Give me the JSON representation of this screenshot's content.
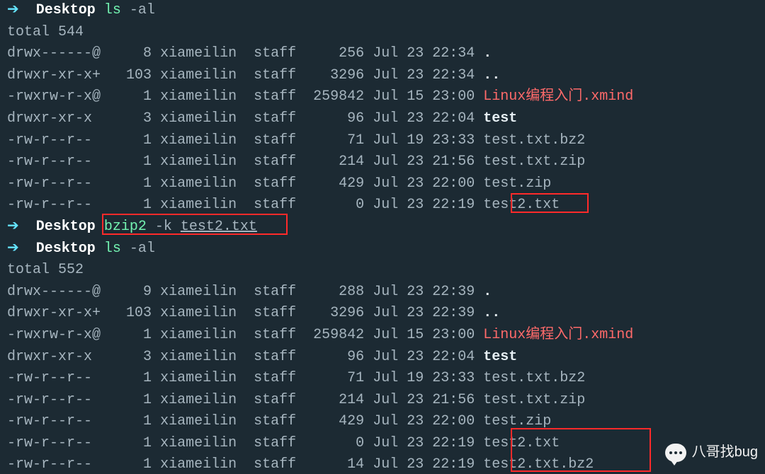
{
  "prompt": {
    "arrow": "➔",
    "path": "Desktop"
  },
  "cmd1": {
    "cmd": "ls",
    "args": "-al"
  },
  "total1": "total 544",
  "rows1": [
    {
      "perm": "drwx------@",
      "links": "8",
      "user": "xiameilin",
      "group": "staff",
      "size": "256",
      "date": "Jul 23 22:34",
      "name": ".",
      "kind": "bold"
    },
    {
      "perm": "drwxr-xr-x+",
      "links": "103",
      "user": "xiameilin",
      "group": "staff",
      "size": "3296",
      "date": "Jul 23 22:34",
      "name": "..",
      "kind": "bold"
    },
    {
      "perm": "-rwxrw-r-x@",
      "links": "1",
      "user": "xiameilin",
      "group": "staff",
      "size": "259842",
      "date": "Jul 15 23:00",
      "name": "Linux编程入门.xmind",
      "kind": "red"
    },
    {
      "perm": "drwxr-xr-x",
      "links": "3",
      "user": "xiameilin",
      "group": "staff",
      "size": "96",
      "date": "Jul 23 22:04",
      "name": "test",
      "kind": "bold"
    },
    {
      "perm": "-rw-r--r--",
      "links": "1",
      "user": "xiameilin",
      "group": "staff",
      "size": "71",
      "date": "Jul 19 23:33",
      "name": "test.txt.bz2",
      "kind": "txt"
    },
    {
      "perm": "-rw-r--r--",
      "links": "1",
      "user": "xiameilin",
      "group": "staff",
      "size": "214",
      "date": "Jul 23 21:56",
      "name": "test.txt.zip",
      "kind": "txt"
    },
    {
      "perm": "-rw-r--r--",
      "links": "1",
      "user": "xiameilin",
      "group": "staff",
      "size": "429",
      "date": "Jul 23 22:00",
      "name": "test.zip",
      "kind": "txt"
    },
    {
      "perm": "-rw-r--r--",
      "links": "1",
      "user": "xiameilin",
      "group": "staff",
      "size": "0",
      "date": "Jul 23 22:19",
      "name": "test2.txt",
      "kind": "txt"
    }
  ],
  "cmd2": {
    "cmd": "bzip2",
    "flag": "-k",
    "arg": "test2.txt"
  },
  "cmd3": {
    "cmd": "ls",
    "args": "-al"
  },
  "total2": "total 552",
  "rows2": [
    {
      "perm": "drwx------@",
      "links": "9",
      "user": "xiameilin",
      "group": "staff",
      "size": "288",
      "date": "Jul 23 22:39",
      "name": ".",
      "kind": "bold"
    },
    {
      "perm": "drwxr-xr-x+",
      "links": "103",
      "user": "xiameilin",
      "group": "staff",
      "size": "3296",
      "date": "Jul 23 22:39",
      "name": "..",
      "kind": "bold"
    },
    {
      "perm": "-rwxrw-r-x@",
      "links": "1",
      "user": "xiameilin",
      "group": "staff",
      "size": "259842",
      "date": "Jul 15 23:00",
      "name": "Linux编程入门.xmind",
      "kind": "red"
    },
    {
      "perm": "drwxr-xr-x",
      "links": "3",
      "user": "xiameilin",
      "group": "staff",
      "size": "96",
      "date": "Jul 23 22:04",
      "name": "test",
      "kind": "bold"
    },
    {
      "perm": "-rw-r--r--",
      "links": "1",
      "user": "xiameilin",
      "group": "staff",
      "size": "71",
      "date": "Jul 19 23:33",
      "name": "test.txt.bz2",
      "kind": "txt"
    },
    {
      "perm": "-rw-r--r--",
      "links": "1",
      "user": "xiameilin",
      "group": "staff",
      "size": "214",
      "date": "Jul 23 21:56",
      "name": "test.txt.zip",
      "kind": "txt"
    },
    {
      "perm": "-rw-r--r--",
      "links": "1",
      "user": "xiameilin",
      "group": "staff",
      "size": "429",
      "date": "Jul 23 22:00",
      "name": "test.zip",
      "kind": "txt"
    },
    {
      "perm": "-rw-r--r--",
      "links": "1",
      "user": "xiameilin",
      "group": "staff",
      "size": "0",
      "date": "Jul 23 22:19",
      "name": "test2.txt",
      "kind": "txt"
    },
    {
      "perm": "-rw-r--r--",
      "links": "1",
      "user": "xiameilin",
      "group": "staff",
      "size": "14",
      "date": "Jul 23 22:19",
      "name": "test2.txt.bz2",
      "kind": "txt"
    }
  ],
  "watermark": "八哥找bug"
}
